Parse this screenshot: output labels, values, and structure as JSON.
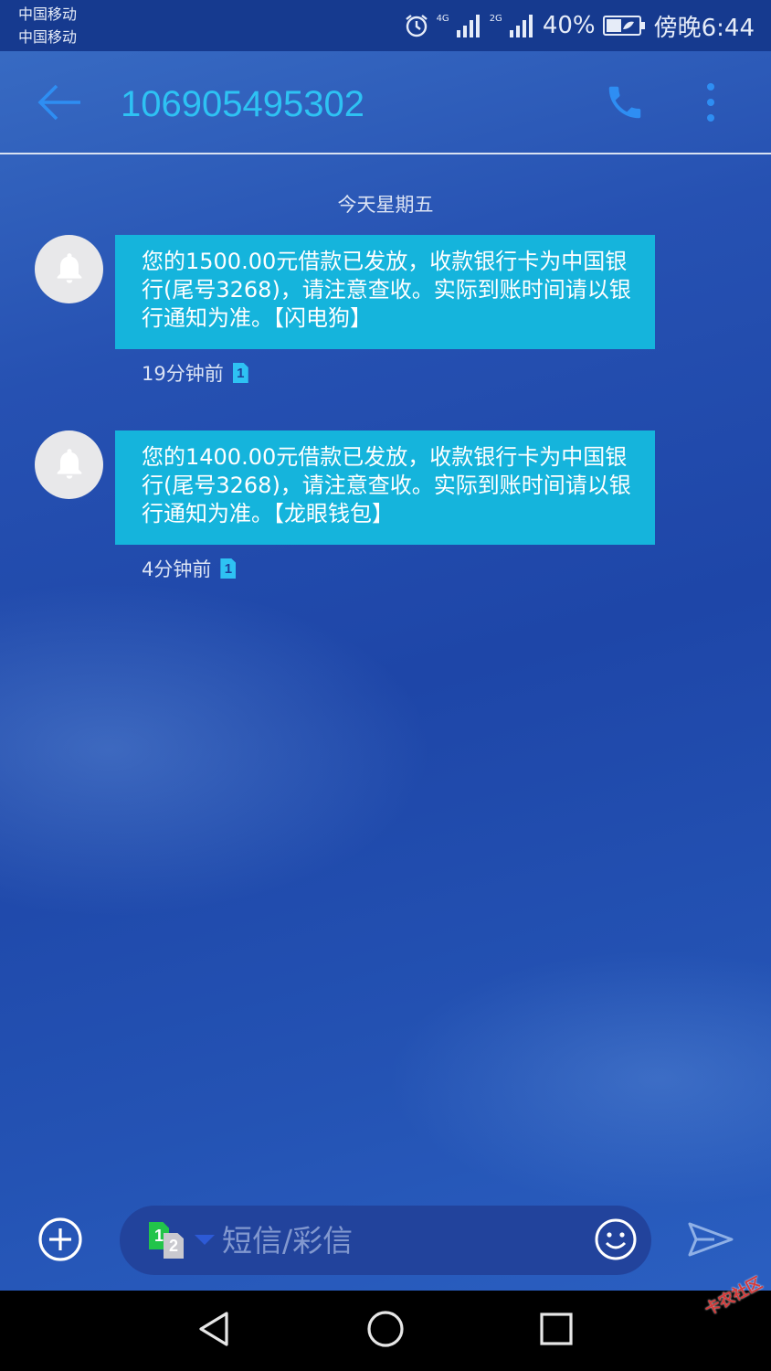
{
  "status_bar": {
    "carrier1": "中国移动",
    "carrier2": "中国移动",
    "net1": "4G",
    "net2": "2G",
    "battery": "40%",
    "time": "傍晚6:44"
  },
  "header": {
    "title": "106905495302"
  },
  "conversation": {
    "date_separator": "今天星期五",
    "messages": [
      {
        "text": "您的1500.00元借款已发放，收款银行卡为中国银行(尾号3268)，请注意查收。实际到账时间请以银行通知为准。【闪电狗】",
        "time": "19分钟前",
        "sim": "1"
      },
      {
        "text": "您的1400.00元借款已发放，收款银行卡为中国银行(尾号3268)，请注意查收。实际到账时间请以银行通知为准。【龙眼钱包】",
        "time": "4分钟前",
        "sim": "1"
      }
    ]
  },
  "composer": {
    "placeholder": "短信/彩信",
    "sim1": "1",
    "sim2": "2"
  },
  "watermark": "卡农社区",
  "colors": {
    "accent": "#2ec2f3",
    "bubble": "#15b4dc",
    "status_bar": "#163a8f",
    "nav_bar": "#000000"
  },
  "icons": {
    "back": "arrow-left-icon",
    "call": "phone-icon",
    "more": "more-vertical-icon",
    "avatar": "bell-icon",
    "add": "plus-circle-icon",
    "emoji": "smiley-icon",
    "send": "send-icon"
  }
}
